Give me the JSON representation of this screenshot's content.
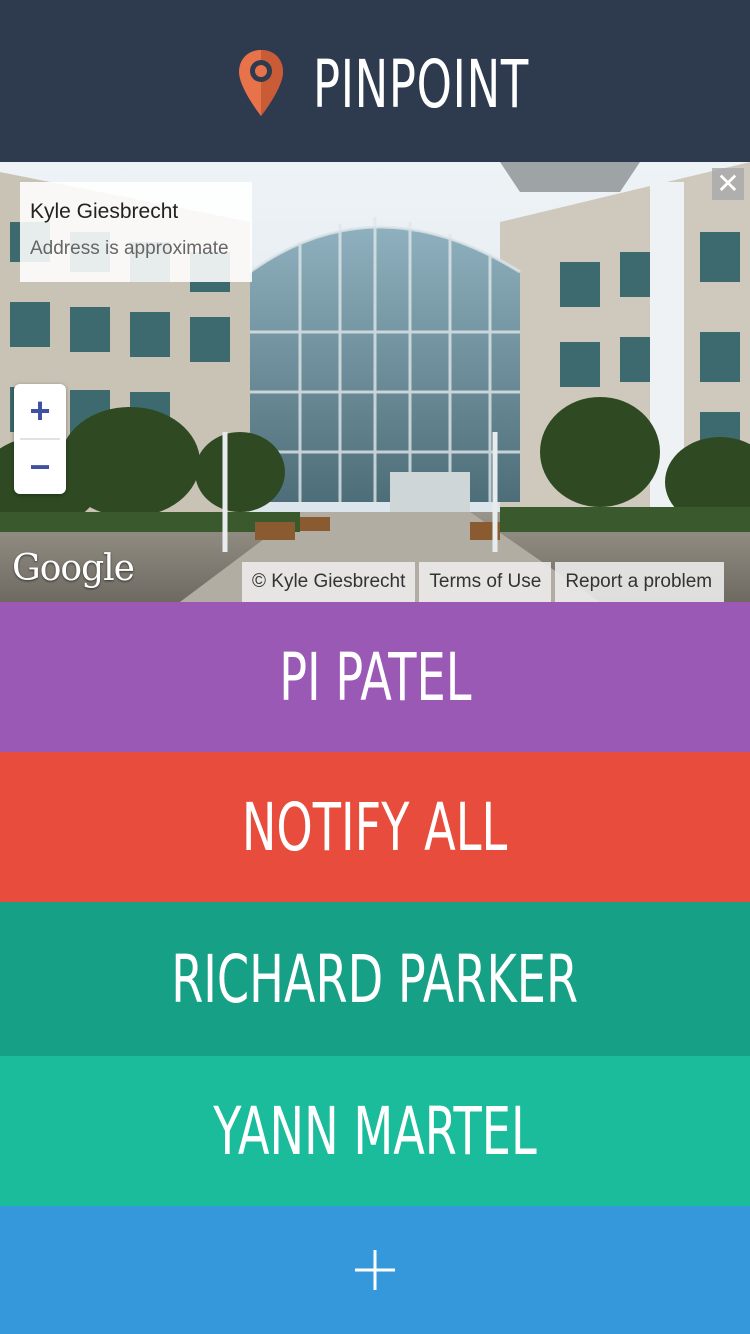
{
  "header": {
    "title": "PINPOINT",
    "logo_icon": "map-pin-icon"
  },
  "map": {
    "info_card": {
      "name": "Kyle Giesbrecht",
      "subtitle": "Address is approximate"
    },
    "close_icon": "close-icon",
    "zoom": {
      "in_label": "+",
      "out_label": "−"
    },
    "provider": "Google",
    "attribution": {
      "copyright": "© Kyle Giesbrecht",
      "terms": "Terms of Use",
      "report": "Report a problem"
    }
  },
  "actions": [
    {
      "label": "PI PATEL",
      "color": "#9b59b6"
    },
    {
      "label": "NOTIFY ALL",
      "color": "#e74c3c"
    },
    {
      "label": "RICHARD PARKER",
      "color": "#16a085"
    },
    {
      "label": "YANN MARTEL",
      "color": "#1abc9c"
    },
    {
      "label": "+",
      "color": "#3498db",
      "icon": "plus-icon"
    }
  ],
  "colors": {
    "header": "#2e3a4e",
    "pin": "#e8734a"
  }
}
